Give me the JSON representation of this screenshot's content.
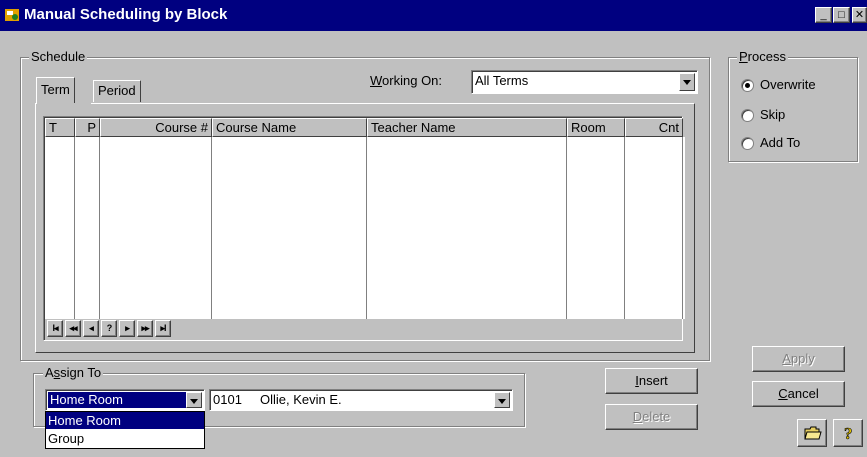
{
  "window": {
    "title": "Manual Scheduling by Block",
    "minimize_glyph": "_",
    "maximize_glyph": "□",
    "close_glyph": "✕"
  },
  "schedule": {
    "group_label": "Schedule",
    "tabs": [
      {
        "label": "Term",
        "selected": true
      },
      {
        "label": "Period",
        "selected": false
      }
    ],
    "working_on": {
      "label_accel": "W",
      "label_rest": "orking On:",
      "value": "All Terms"
    },
    "grid": {
      "columns": [
        "T",
        "P",
        "Course #",
        "Course Name",
        "Teacher Name",
        "Room",
        "Cnt"
      ],
      "rows": [],
      "nav_buttons": [
        "I◂",
        "◂◂",
        "◂",
        "?",
        "▸",
        "▸▸",
        "▸I"
      ]
    }
  },
  "assign_to": {
    "label_pre": "A",
    "label_accel": "s",
    "label_rest": "sign To",
    "type_value": "Home Room",
    "type_options": [
      "Home Room",
      "Group"
    ],
    "target_value": "0101     Ollie, Kevin E."
  },
  "buttons": {
    "insert_accel": "I",
    "insert_rest": "nsert",
    "delete_accel": "D",
    "delete_rest": "elete",
    "apply_accel": "A",
    "apply_rest": "pply",
    "cancel_accel": "C",
    "cancel_rest": "ancel"
  },
  "process": {
    "label_accel": "P",
    "label_rest": "rocess",
    "options": [
      {
        "label": "Overwrite",
        "checked": true
      },
      {
        "label": "Skip",
        "checked": false
      },
      {
        "label": "Add To",
        "checked": false
      }
    ]
  },
  "colors": {
    "titlebar": "#000080",
    "face": "#c0c0c0",
    "highlight": "#000080",
    "disabled_text": "#808080"
  },
  "icons": [
    "app-icon",
    "folder-icon",
    "help-question-icon"
  ]
}
